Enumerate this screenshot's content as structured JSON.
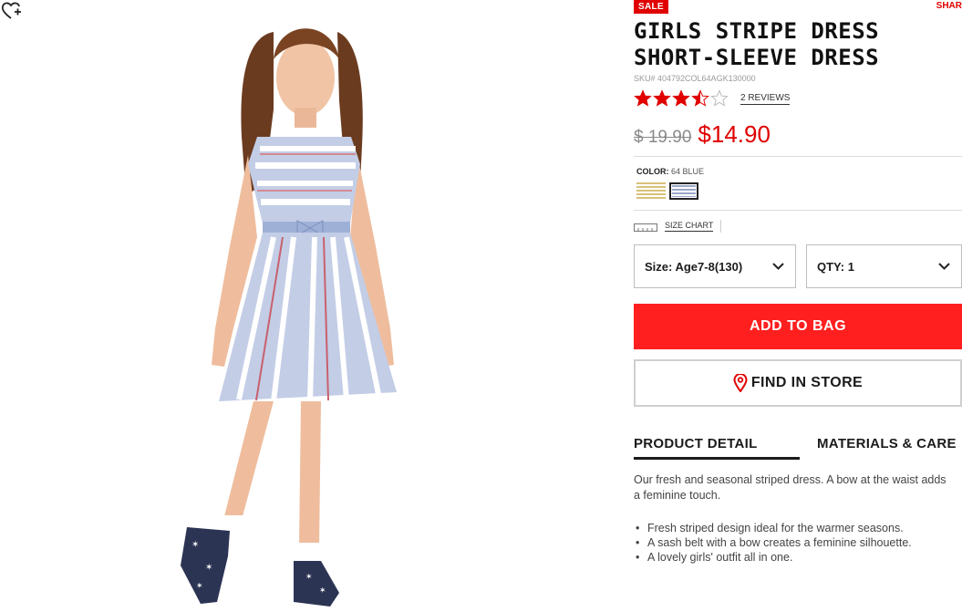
{
  "product": {
    "badge": "SALE",
    "share_label": "SHAR",
    "title_line1": "GIRLS STRIPE DRESS",
    "title_line2": "SHORT-SLEEVE DRESS",
    "sku": "SKU# 404792COL64AGK130000",
    "rating": 3.5,
    "rating_max": 5,
    "reviews_label": "2 REVIEWS",
    "original_price": "$ 19.90",
    "sale_price": "$14.90"
  },
  "color": {
    "label": "COLOR:",
    "value": "64 BLUE",
    "swatches": [
      {
        "name": "yellow-stripe",
        "selected": false
      },
      {
        "name": "blue-stripe",
        "selected": true
      }
    ]
  },
  "size_chart": {
    "label": "SIZE CHART",
    "icon": "ruler-icon"
  },
  "selects": {
    "size": {
      "value": "Size: Age7-8(130)"
    },
    "qty": {
      "value": "QTY: 1"
    }
  },
  "actions": {
    "add_to_bag": "ADD TO BAG",
    "find_in_store": "FIND IN STORE"
  },
  "tabs": [
    {
      "label": "PRODUCT DETAIL",
      "active": true
    },
    {
      "label": "MATERIALS & CARE",
      "active": false
    }
  ],
  "details": {
    "description": "Our fresh and seasonal striped dress. A bow at the waist adds a feminine touch.",
    "bullets": [
      "Fresh striped design ideal for the warmer seasons.",
      "A sash belt with a bow creates a feminine silhouette.",
      "A lovely girls' outfit all in one."
    ]
  },
  "colors": {
    "accent": "#e00000",
    "button": "#ff1f1f"
  }
}
